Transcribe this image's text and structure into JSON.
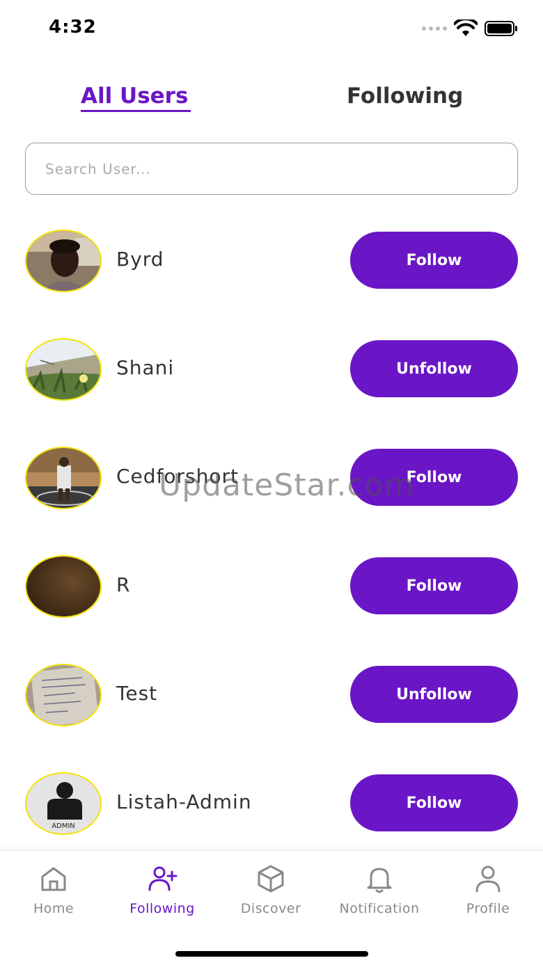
{
  "status_bar": {
    "time": "4:32"
  },
  "tabs": [
    {
      "label": "All Users",
      "active": true
    },
    {
      "label": "Following",
      "active": false
    }
  ],
  "search": {
    "placeholder": "Search User...",
    "value": ""
  },
  "users": [
    {
      "name": "Byrd",
      "action": "Follow"
    },
    {
      "name": "Shani",
      "action": "Unfollow"
    },
    {
      "name": "Cedforshort",
      "action": "Follow"
    },
    {
      "name": "R",
      "action": "Follow"
    },
    {
      "name": "Test",
      "action": "Unfollow"
    },
    {
      "name": "Listah-Admin",
      "action": "Follow",
      "avatar_text": "ADMIN"
    }
  ],
  "watermark": "UpdateStar.com",
  "bottom_nav": [
    {
      "label": "Home",
      "icon": "home-icon",
      "active": false
    },
    {
      "label": "Following",
      "icon": "user-plus-icon",
      "active": true
    },
    {
      "label": "Discover",
      "icon": "box-icon",
      "active": false
    },
    {
      "label": "Notification",
      "icon": "bell-icon",
      "active": false
    },
    {
      "label": "Profile",
      "icon": "user-icon",
      "active": false
    }
  ],
  "colors": {
    "accent": "#6a16c6",
    "avatar_border": "#f2e200"
  }
}
